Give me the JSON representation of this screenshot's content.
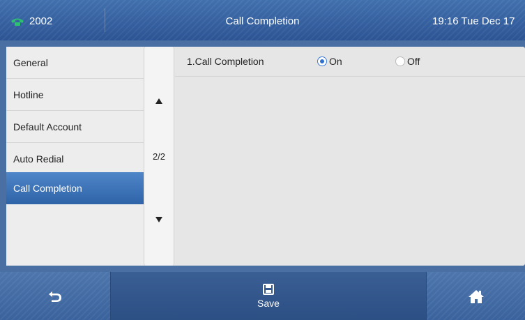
{
  "header": {
    "account": "2002",
    "title": "Call Completion",
    "clock": "19:16 Tue Dec 17"
  },
  "menu": {
    "items": [
      {
        "label": "General"
      },
      {
        "label": "Hotline"
      },
      {
        "label": "Default Account"
      },
      {
        "label": "Auto Redial"
      },
      {
        "label": "Call Completion"
      }
    ],
    "active": "Call Completion"
  },
  "pager": {
    "page": "2/2"
  },
  "settings": {
    "call_completion": {
      "label": "1.Call Completion",
      "on_label": "On",
      "off_label": "Off",
      "value": "On"
    }
  },
  "softkeys": {
    "save_label": "Save"
  },
  "colors": {
    "accent": "#2e63a8",
    "phone_icon": "#2fbf71"
  }
}
